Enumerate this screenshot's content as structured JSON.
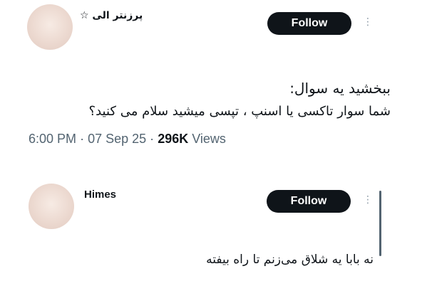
{
  "tweet": {
    "author_name": "پرزنتر الی ☆",
    "follow_label": "Follow",
    "more_icon": "more-dots-icon",
    "text_line1": "ببخشید یه سوال:",
    "text_line2": "شما سوار تاکسی یا اسنپ ، تپسی میشید سلام می کنید؟",
    "time": "6:00 PM",
    "separator1": "·",
    "date": "07 Sep 25",
    "separator2": "·",
    "views_count": "296K",
    "views_label": "Views"
  },
  "reply": {
    "author_name": "Himes",
    "follow_label": "Follow",
    "more_icon": "more-dots-icon",
    "text": "نه بابا یه شلاق می‌زنم تا راه بیفته"
  }
}
